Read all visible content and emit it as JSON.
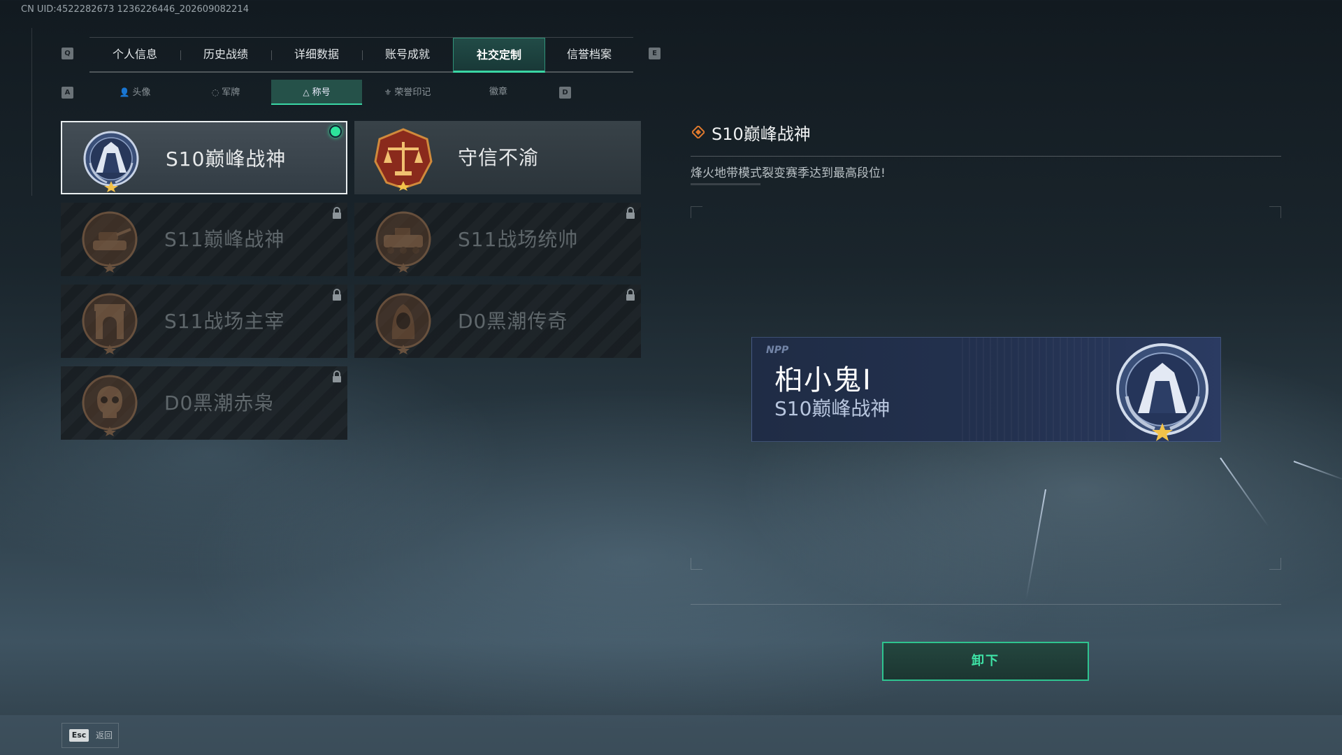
{
  "uid_text": "CN UID:4522282673 1236226446_202609082214",
  "main_tabs": {
    "left_key": "Q",
    "right_key": "E",
    "items": [
      {
        "label": "个人信息"
      },
      {
        "label": "历史战绩"
      },
      {
        "label": "详细数据"
      },
      {
        "label": "账号成就"
      },
      {
        "label": "社交定制",
        "active": true
      },
      {
        "label": "信誉档案"
      }
    ]
  },
  "sub_tabs": {
    "left_key": "A",
    "right_key": "D",
    "items": [
      {
        "label": "头像",
        "icon": "person-icon"
      },
      {
        "label": "军牌",
        "icon": "dogtag-icon"
      },
      {
        "label": "称号",
        "icon": "title-icon",
        "active": true
      },
      {
        "label": "荣誉印记",
        "icon": "honor-mark-icon"
      },
      {
        "label": "徽章",
        "icon": ""
      }
    ]
  },
  "titles": [
    {
      "name": "S10巅峰战神",
      "emblem": "blue-fortress-emblem",
      "state": "selected",
      "equipped": true
    },
    {
      "name": "守信不渝",
      "emblem": "red-scales-emblem",
      "state": "unlocked"
    },
    {
      "name": "S11巅峰战神",
      "emblem": "bronze-tank-emblem",
      "state": "locked"
    },
    {
      "name": "S11战场统帅",
      "emblem": "bronze-apc-emblem",
      "state": "locked"
    },
    {
      "name": "S11战场主宰",
      "emblem": "bronze-arch-emblem",
      "state": "locked"
    },
    {
      "name": "D0黑潮传奇",
      "emblem": "bronze-hooded-emblem",
      "state": "locked"
    },
    {
      "name": "D0黑潮赤枭",
      "emblem": "bronze-skull-emblem",
      "state": "locked"
    }
  ],
  "detail": {
    "title": "S10巅峰战神",
    "description": "烽火地带模式裂变赛季达到最高段位!"
  },
  "name_card": {
    "logo": "NPP",
    "player_name": "桕小鬼I",
    "title": "S10巅峰战神"
  },
  "action_button": "卸下",
  "footer": {
    "esc_key": "Esc",
    "back_label": "返回"
  },
  "colors": {
    "accent_green": "#3ad6a4",
    "equipped_dot": "#2de39b",
    "selected_border": "#e9eef0",
    "diamond_orange": "#e07a2e"
  }
}
